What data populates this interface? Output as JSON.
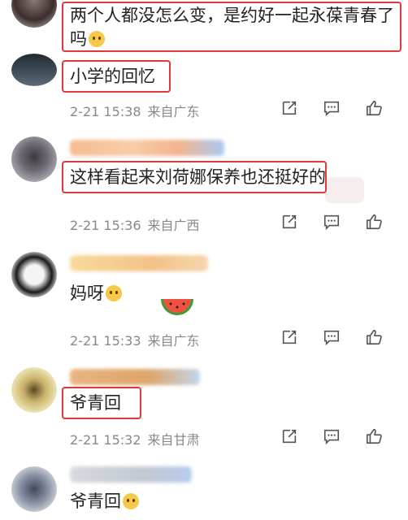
{
  "comments": [
    {
      "text": "两个人都没怎么变，是约好一起永葆青春了",
      "text_line2": "吗",
      "emoji": "astonished-emoji"
    },
    {
      "text": "小学的回忆",
      "date": "2-21 15:38",
      "location": "来自广东"
    },
    {
      "text": "这样看起来刘荷娜保养也还挺好的",
      "date": "2-21 15:36",
      "location": "来自广西"
    },
    {
      "text": "妈呀",
      "emoji": "crying-emoji",
      "sticker": "watermelon-sticker",
      "date": "2-21 15:33",
      "location": "来自广东"
    },
    {
      "text": "爷青回",
      "date": "2-21 15:32",
      "location": "来自甘肃"
    },
    {
      "text": "爷青回",
      "emoji": "crying-emoji"
    }
  ],
  "icons": {
    "share": "share-icon",
    "comment": "comment-icon",
    "like": "thumbs-up-icon"
  },
  "colors": {
    "highlight_border": "#e0393b",
    "meta_text": "#888888"
  }
}
